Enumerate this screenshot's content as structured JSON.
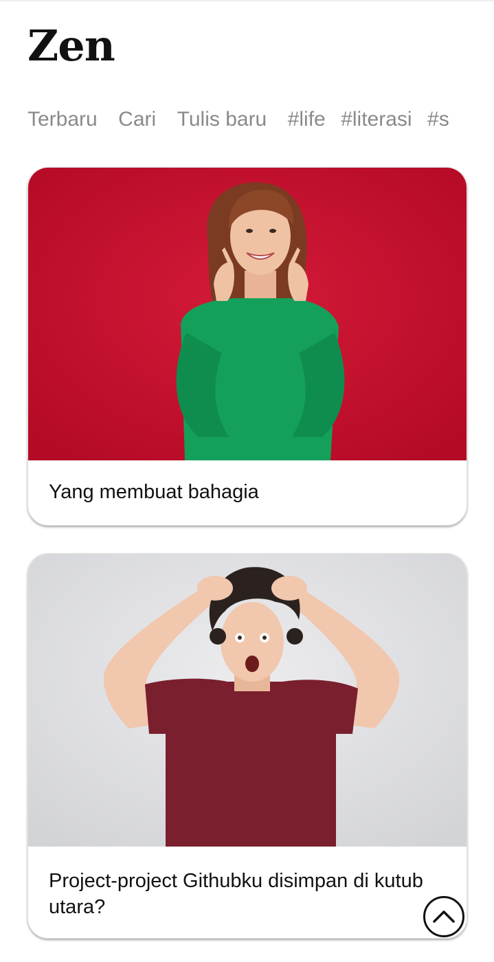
{
  "site": {
    "brand": "Zen"
  },
  "nav": {
    "items": [
      {
        "label": "Terbaru"
      },
      {
        "label": "Cari"
      },
      {
        "label": "Tulis baru"
      },
      {
        "label": "#life"
      },
      {
        "label": "#literasi"
      },
      {
        "label": "#s"
      }
    ]
  },
  "posts": [
    {
      "title": "Yang membuat bahagia",
      "image_icon": "woman-smiling-photo",
      "colors": {
        "background": "#c8102e",
        "sweater": "#129a54"
      }
    },
    {
      "title": "Project-project Githubku disimpan di kutub utara?",
      "image_icon": "surprised-man-photo",
      "colors": {
        "background": "#dcdde0",
        "shirt": "#7a1f2e"
      }
    }
  ],
  "scroll_top": {
    "icon": "chevron-up-icon"
  }
}
